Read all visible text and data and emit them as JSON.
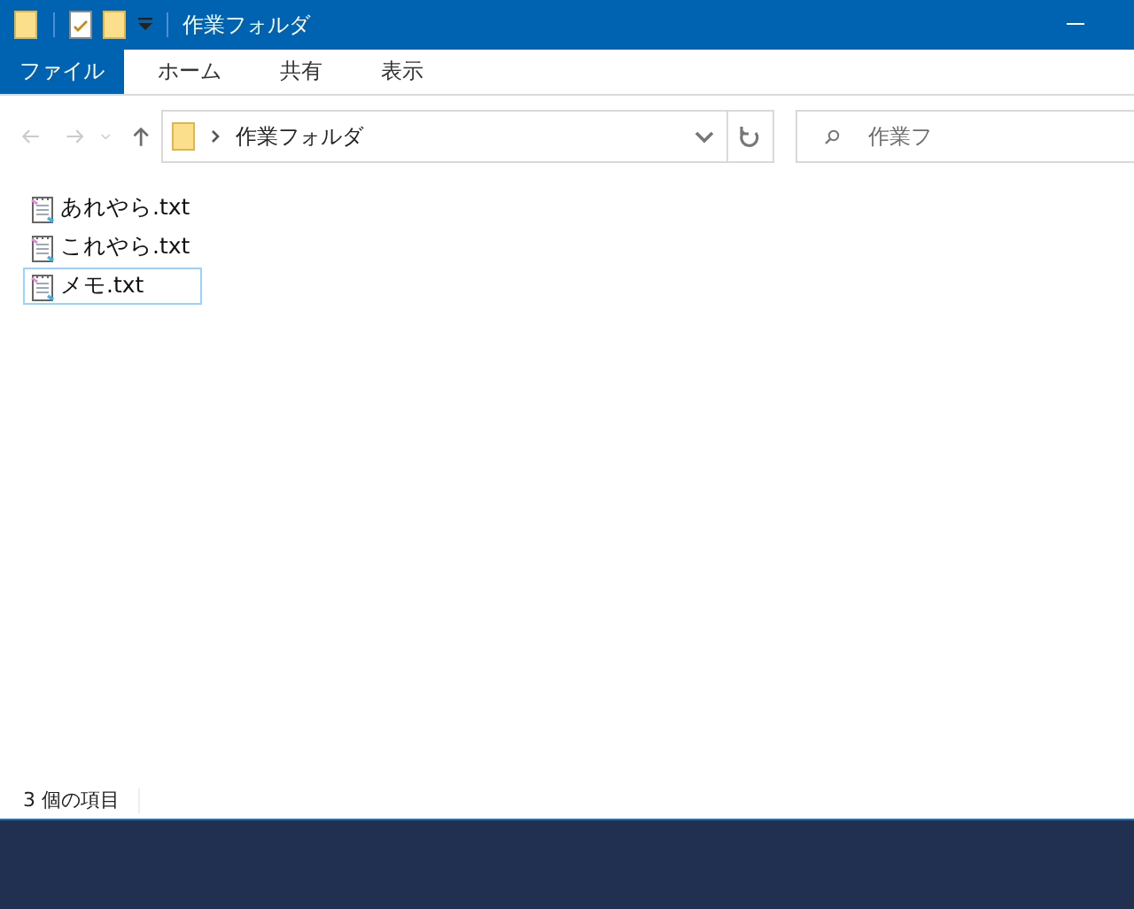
{
  "window": {
    "title": "作業フォルダ"
  },
  "ribbon_tabs": [
    {
      "label": "ファイル",
      "selected": true
    },
    {
      "label": "ホーム",
      "selected": false
    },
    {
      "label": "共有",
      "selected": false
    },
    {
      "label": "表示",
      "selected": false
    }
  ],
  "address_bar": {
    "path": "作業フォルダ"
  },
  "search": {
    "placeholder": "作業フ"
  },
  "files": [
    {
      "name": "あれやら.txt",
      "selected": false
    },
    {
      "name": "これやら.txt",
      "selected": false
    },
    {
      "name": "メモ.txt",
      "selected": true
    }
  ],
  "status_bar": {
    "item_count": "3 個の項目"
  }
}
